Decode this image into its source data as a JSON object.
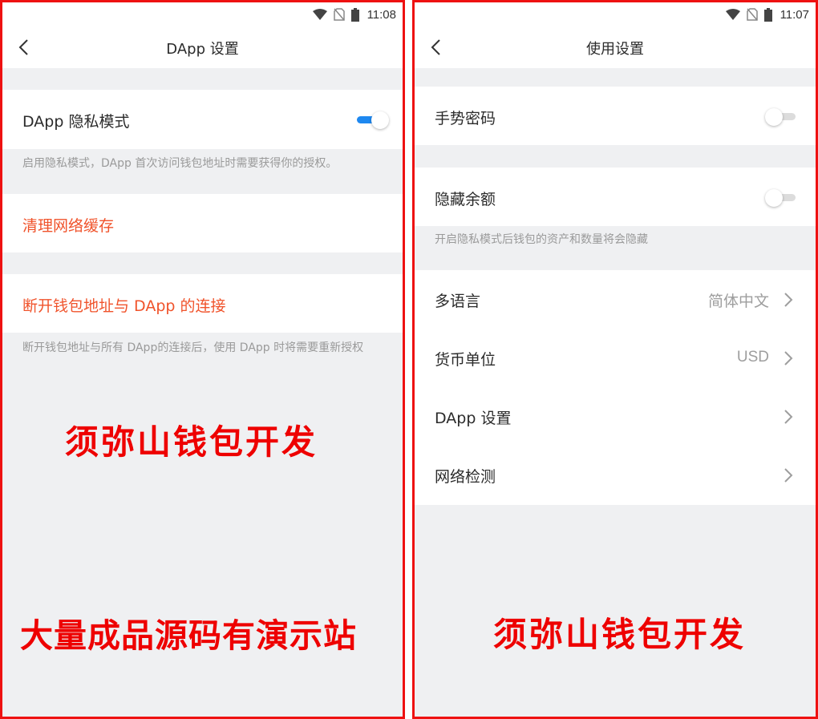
{
  "status_time_left": "11:08",
  "status_time_right": "11:07",
  "left": {
    "title": "DApp 设置",
    "privacy_mode_label": "DApp 隐私模式",
    "privacy_mode_on": true,
    "privacy_note": "启用隐私模式，DApp 首次访问钱包地址时需要获得你的授权。",
    "clear_cache_label": "清理网络缓存",
    "disconnect_label": "断开钱包地址与 DApp 的连接",
    "disconnect_note": "断开钱包地址与所有 DApp的连接后，使用 DApp 时将需要重新授权"
  },
  "right": {
    "title": "使用设置",
    "gesture_password_label": "手势密码",
    "gesture_password_on": false,
    "hide_balance_label": "隐藏余额",
    "hide_balance_on": false,
    "hide_balance_note": "开启隐私模式后钱包的资产和数量将会隐藏",
    "language_label": "多语言",
    "language_value": "简体中文",
    "currency_label": "货币单位",
    "currency_value": "USD",
    "dapp_settings_label": "DApp 设置",
    "network_check_label": "网络检测"
  },
  "watermark": {
    "left_top": "须弥山钱包开发",
    "left_bottom": "大量成品源码有演示站",
    "right_bottom": "须弥山钱包开发"
  },
  "colors": {
    "accent": "#1e88f0",
    "warning_text": "#f0532b",
    "watermark": "#ee0000",
    "page_bg": "#eff0f2",
    "border": "#ee1111"
  }
}
